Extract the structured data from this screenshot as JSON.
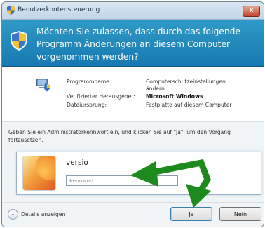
{
  "window": {
    "title": "Benutzerkontensteuerung",
    "close_label": "x"
  },
  "banner": {
    "question": "Möchten Sie zulassen, dass durch das folgende Programm Änderungen an diesem Computer vorgenommen werden?"
  },
  "details": {
    "program_name_label": "Programmname:",
    "program_name_value": "Computerschutzeinstellungen ändern",
    "publisher_label": "Verifizierter Herausgeber:",
    "publisher_value": "Microsoft Windows",
    "origin_label": "Dateiursprung:",
    "origin_value": "Festplatte auf diesem Computer"
  },
  "credentials": {
    "instruction": "Geben Sie ein Administratorkennwort ein, und klicken Sie auf \"Ja\", um den Vorgang fortzusetzen.",
    "username": "versio",
    "password_placeholder": "Kennwort"
  },
  "footer": {
    "details_label": "Details anzeigen",
    "yes_label": "Ja",
    "no_label": "Nein"
  },
  "colors": {
    "banner": "#1f86bb",
    "annotation_arrow": "#1d8a1d"
  },
  "icons": [
    "uac-shield-icon",
    "program-icon",
    "user-avatar-icon",
    "chevron-down-icon",
    "close-icon",
    "annotation-arrow-icon"
  ]
}
